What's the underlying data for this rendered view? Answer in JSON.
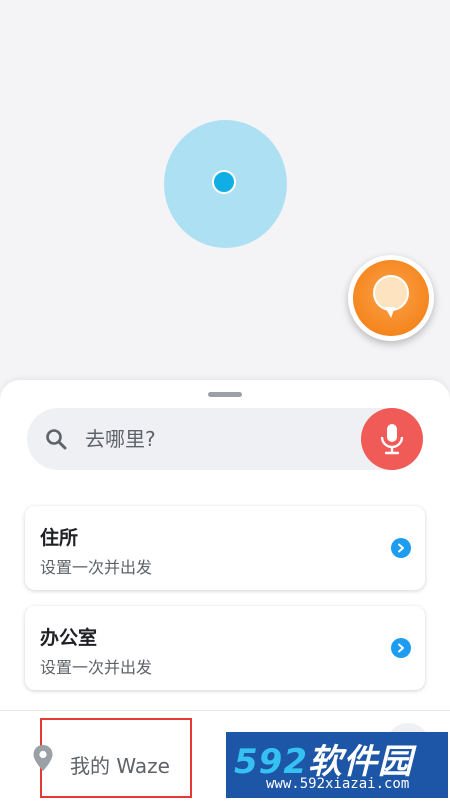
{
  "search": {
    "placeholder": "去哪里?"
  },
  "favorites": [
    {
      "title": "住所",
      "subtitle": "设置一次并出发"
    },
    {
      "title": "办公室",
      "subtitle": "设置一次并出发"
    }
  ],
  "bottom_bar": {
    "my_waze_label": "我的 Waze"
  },
  "watermark": {
    "digits": "592",
    "text": "软件园",
    "url": "www.592xiazai.com"
  },
  "icons": {
    "search": "search-icon",
    "mic": "microphone-icon",
    "chevron": "chevron-right-icon",
    "pin": "location-pin-icon",
    "report": "report-icon"
  },
  "colors": {
    "accuracy": "#aee0f3",
    "location": "#11aee6",
    "mic": "#f05a57",
    "chevron": "#1e9cf0",
    "report": "#f5861e",
    "highlight": "#e53935"
  }
}
